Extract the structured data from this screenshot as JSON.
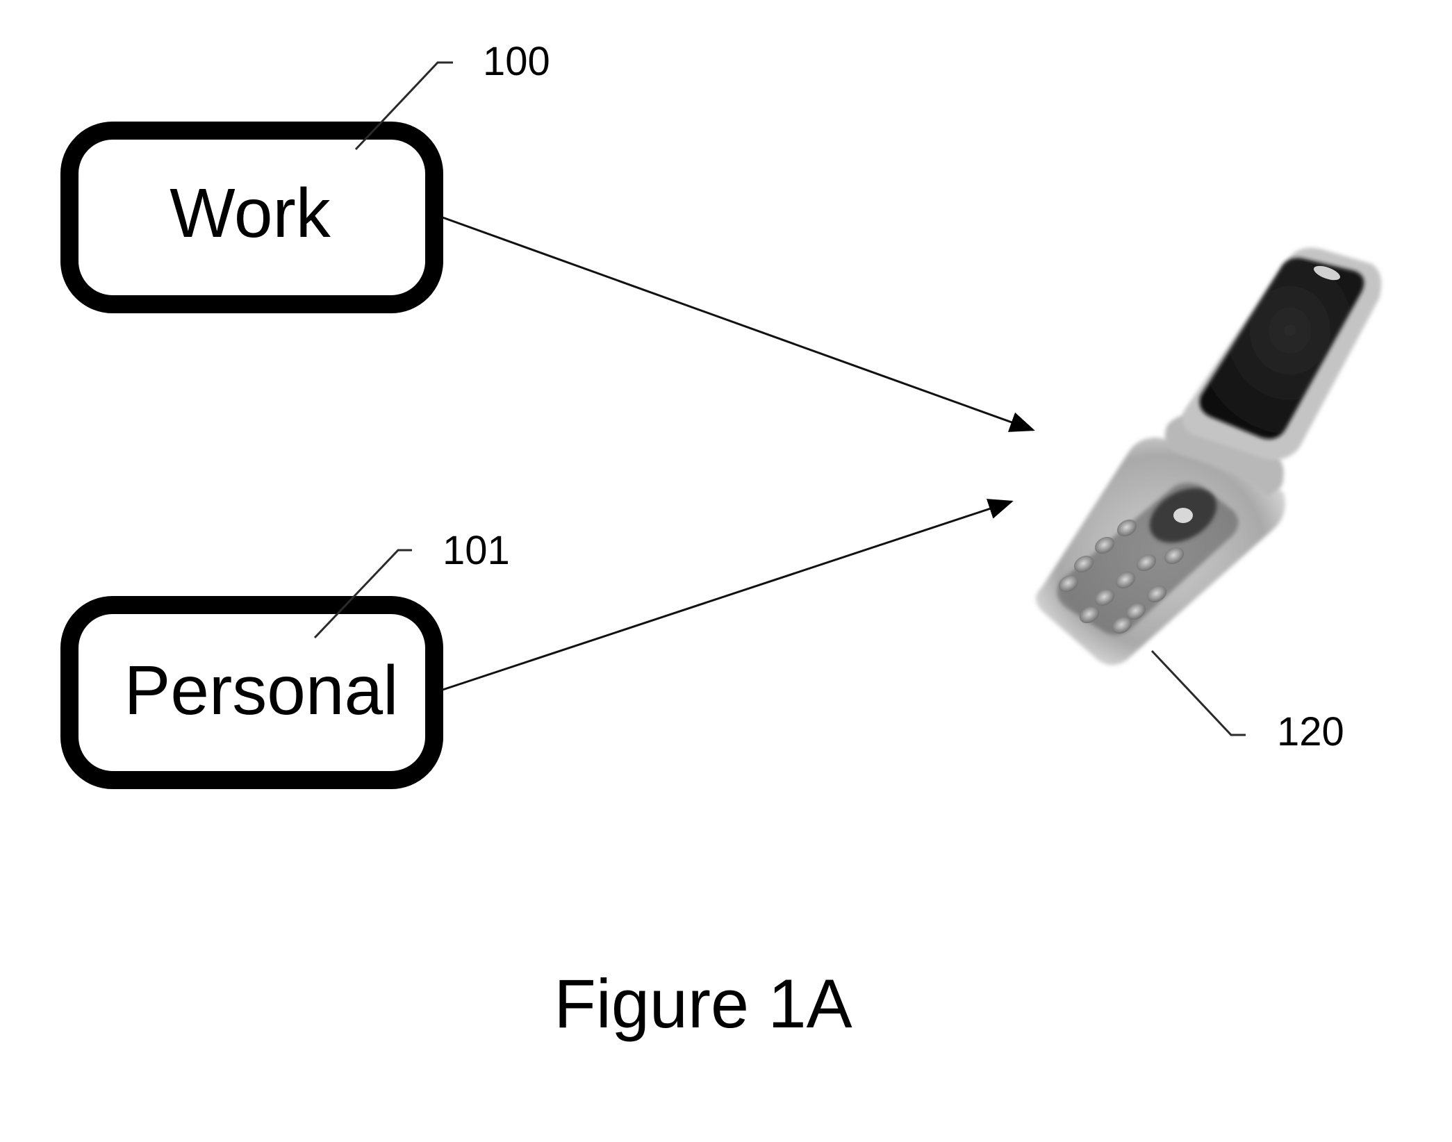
{
  "figure": {
    "caption": "Figure 1A",
    "nodes": [
      {
        "id": "work",
        "label": "Work",
        "ref": "100"
      },
      {
        "id": "personal",
        "label": "Personal",
        "ref": "101"
      }
    ],
    "device": {
      "id": "mobile-phone",
      "kind": "flip phone",
      "ref": "120",
      "icon": "flip-phone-icon"
    },
    "edges": [
      {
        "from": "work",
        "to": "mobile-phone"
      },
      {
        "from": "personal",
        "to": "mobile-phone"
      }
    ],
    "colors": {
      "ink": "#000000",
      "phone_dark": "#1a1a1a",
      "phone_mid": "#8a8a8a",
      "phone_light": "#d6d6d6"
    }
  }
}
